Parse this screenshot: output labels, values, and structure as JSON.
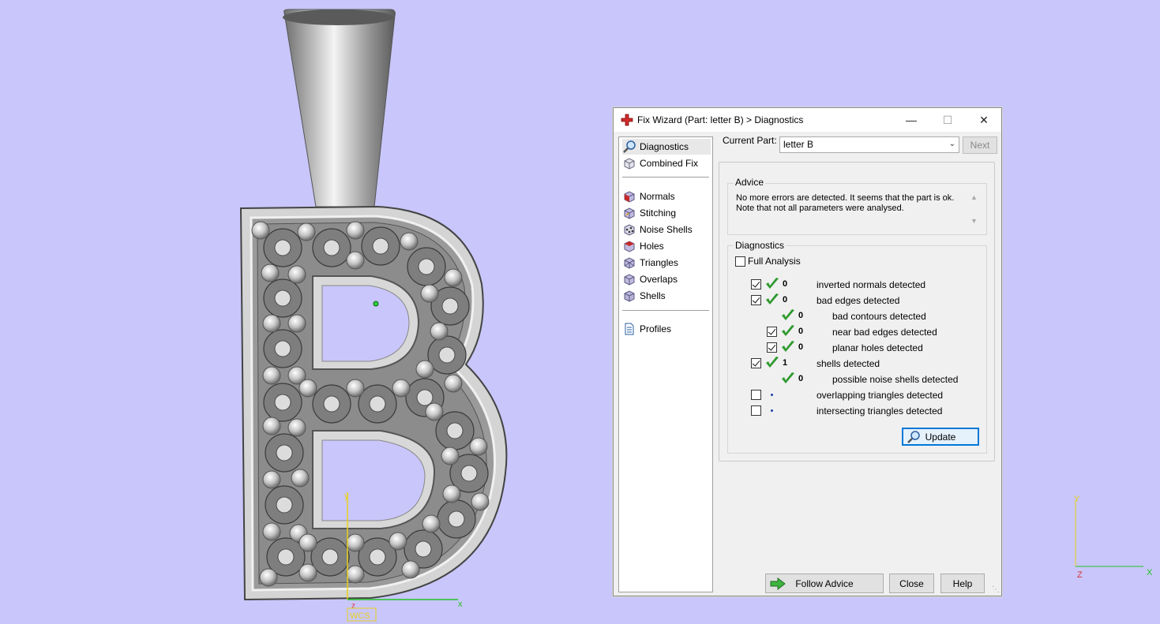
{
  "viewport": {
    "wcs_label": "WCS",
    "axis_x": "x",
    "axis_y": "y",
    "axis_z": "z",
    "corner_axis_x": "X",
    "corner_axis_y": "Y",
    "corner_axis_z": "Z"
  },
  "dialog": {
    "title": "Fix Wizard (Part: letter B) > Diagnostics",
    "min_glyph": "—",
    "max_glyph": "☐",
    "close_glyph": "✕",
    "nav": [
      {
        "label": "Diagnostics",
        "icon": "magnifier-icon"
      },
      {
        "label": "Combined Fix",
        "icon": "cube-fix-icon"
      },
      {
        "label": "Normals",
        "icon": "normals-cube-icon"
      },
      {
        "label": "Stitching",
        "icon": "stitching-cube-icon"
      },
      {
        "label": "Noise Shells",
        "icon": "noise-shells-icon"
      },
      {
        "label": "Holes",
        "icon": "holes-cube-icon"
      },
      {
        "label": "Triangles",
        "icon": "triangles-cube-icon"
      },
      {
        "label": "Overlaps",
        "icon": "overlaps-cube-icon"
      },
      {
        "label": "Shells",
        "icon": "shells-cube-icon"
      },
      {
        "label": "Profiles",
        "icon": "document-icon"
      }
    ],
    "current_part_label": "Current Part:",
    "current_part_value": "letter B",
    "next_label": "Next",
    "advice_title": "Advice",
    "advice_text": "No more errors are detected. It seems that the part is ok. Note that not all parameters were analysed.",
    "diagnostics_title": "Diagnostics",
    "full_analysis_label": "Full Analysis",
    "rows": [
      {
        "checkbox": true,
        "checked": true,
        "status": "ok",
        "value": "0",
        "label": "inverted normals detected",
        "indent": 0
      },
      {
        "checkbox": true,
        "checked": true,
        "status": "ok",
        "value": "0",
        "label": "bad edges detected",
        "indent": 0
      },
      {
        "checkbox": false,
        "checked": false,
        "status": "ok",
        "value": "0",
        "label": "bad contours detected",
        "indent": 1
      },
      {
        "checkbox": true,
        "checked": true,
        "status": "ok",
        "value": "0",
        "label": "near bad edges detected",
        "indent": 1
      },
      {
        "checkbox": true,
        "checked": true,
        "status": "ok",
        "value": "0",
        "label": "planar holes detected",
        "indent": 1
      },
      {
        "checkbox": true,
        "checked": true,
        "status": "ok",
        "value": "1",
        "label": "shells detected",
        "indent": 0
      },
      {
        "checkbox": false,
        "checked": false,
        "status": "ok",
        "value": "0",
        "label": "possible noise shells detected",
        "indent": 1
      },
      {
        "checkbox": true,
        "checked": false,
        "status": "pending",
        "value": "",
        "label": "overlapping triangles detected",
        "indent": 0
      },
      {
        "checkbox": true,
        "checked": false,
        "status": "pending",
        "value": "",
        "label": "intersecting triangles detected",
        "indent": 0
      }
    ],
    "update_label": "Update",
    "follow_label": "Follow Advice",
    "close_label": "Close",
    "help_label": "Help"
  },
  "colors": {
    "background": "#c8c6fa",
    "check_green": "#2f9a2f",
    "accent": "#0078d7"
  }
}
